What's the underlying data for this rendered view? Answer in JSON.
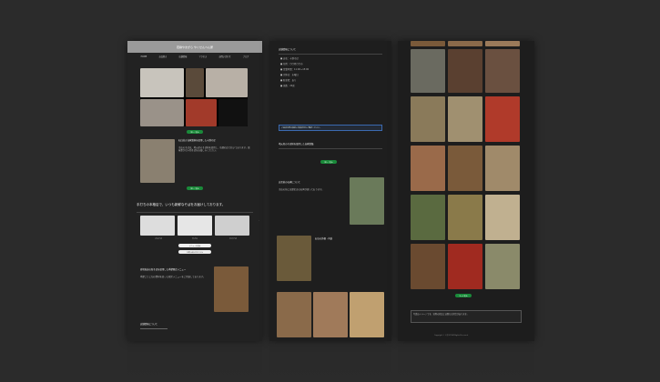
{
  "page1": {
    "header_title": "若柳やまがら やくせんべん屋",
    "nav": [
      "HOME",
      "お品書き",
      "店舗情報",
      "アクセス",
      "お問い合わせ",
      "ブログ"
    ],
    "hero_btn": "詳しく見る",
    "section1_title": "石臼挂き自家製粉を使用した十割そば",
    "section1_body": "当店のそばは、地元産のそば粉を使用し、毎朝石臼で挂いております。風味豊かな十割そばをお楽しみください。",
    "section1_btn": "詳しく見る",
    "big_text": "手打ちの本格店で、いつも新鮮なそばをお届けしております。",
    "captions": [
      "ざるそば",
      "天ざる",
      "かけそば"
    ],
    "white_btn1": "メニューを見る",
    "white_btn2": "お問い合わせはこちら",
    "section2_title": "産地直送の新そばを使用した季節限定メニュー",
    "section2_body": "季節ごとに旬の食材を使った限定メニューをご用意しております。",
    "bottom_title": "店舗情報について"
  },
  "page2": {
    "info_title": "店舗情報について",
    "info_lines": [
      "■ 店名：十割そば",
      "■ 住所：〇〇県〇〇市",
      "■ 営業時間：11:00〜15:00",
      "■ 定休日：水曜日",
      "■ 駐車場：あり",
      "■ 席数：24席"
    ],
    "blue_note": "ご来店の際は事前に営業状況をご確認ください。",
    "section_title": "地元産のそば粉を使用した自家製麺",
    "section_btn": "詳しく見る",
    "monument_title": "店舎前の石碑について",
    "monument_body": "当店の前には歴史ある石碑が建っております。",
    "shop_title": "お店の外観・内装"
  },
  "page3": {
    "btn": "もっと見る",
    "note": "写真はイメージです。実際の商品とは異なる場合があります。",
    "footer": "Copyright © 十割そば All Rights Reserved."
  },
  "colors": {
    "background": "#2b2b2b",
    "green_button": "#1a8a3a",
    "header_gray": "#9a9a9a",
    "note_border": "#3b6ab0"
  }
}
